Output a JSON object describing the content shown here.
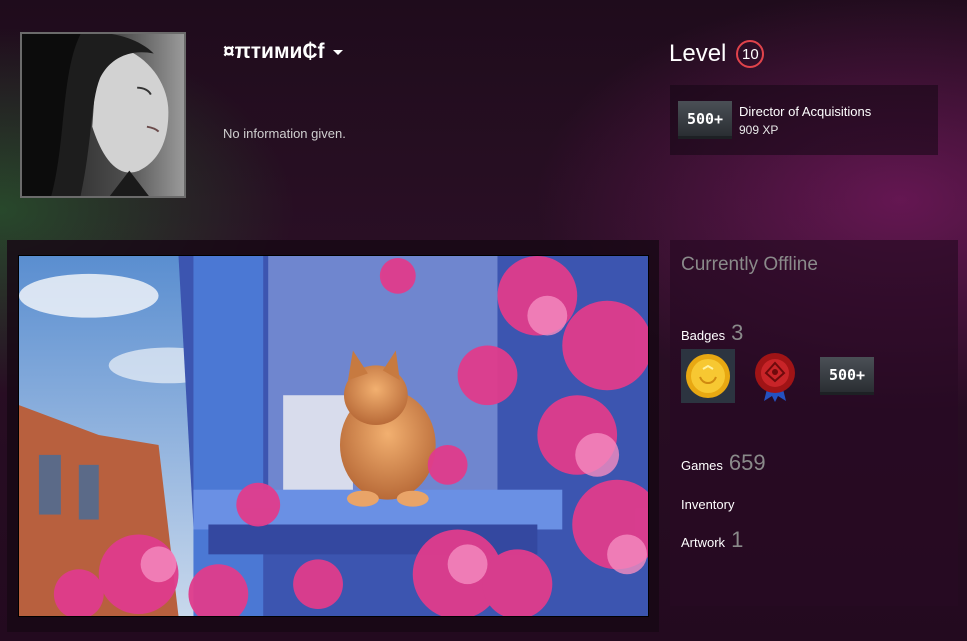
{
  "profile": {
    "persona_name": "¤πтими₵f",
    "summary": "No information given."
  },
  "level": {
    "label": "Level",
    "value": "10",
    "accent_color": "#e0434b"
  },
  "favorite_badge": {
    "icon_text": "500+",
    "name": "Director of Acquisitions",
    "xp": "909 XP"
  },
  "sidebar": {
    "status": "Currently Offline",
    "badges": {
      "label": "Badges",
      "count": "3"
    },
    "badge_icons": [
      {
        "name": "gold-coin-icon"
      },
      {
        "name": "wax-seal-ribbon-icon"
      },
      {
        "name": "games-500-icon",
        "text": "500+"
      }
    ],
    "games": {
      "label": "Games",
      "count": "659"
    },
    "inventory": {
      "label": "Inventory"
    },
    "artwork": {
      "label": "Artwork",
      "count": "1"
    }
  }
}
